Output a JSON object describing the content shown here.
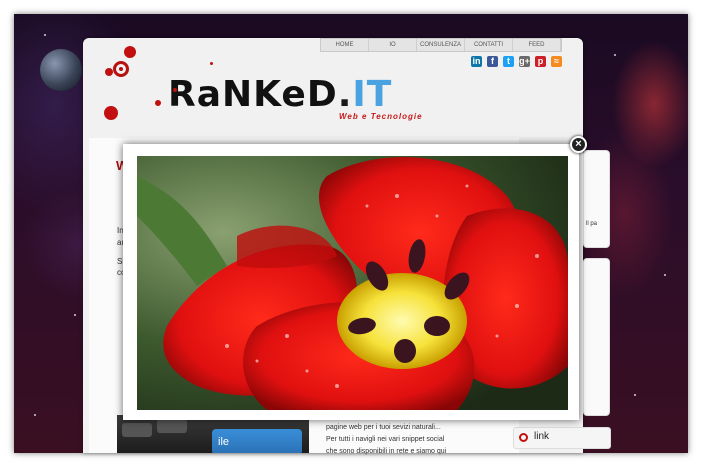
{
  "nav": {
    "items": [
      "HOME",
      "IO",
      "CONSULENZA",
      "CONTATTI",
      "FEED"
    ]
  },
  "social": {
    "icons": [
      "linkedin-icon",
      "facebook-icon",
      "twitter-icon",
      "googleplus-icon",
      "pinterest-icon",
      "rss-icon"
    ],
    "glyphs": [
      "in",
      "f",
      "t",
      "g+",
      "p",
      "≈"
    ],
    "colors": [
      "#0e76a8",
      "#3b5998",
      "#1da1f2",
      "#6a6a6a",
      "#cb2027",
      "#f58a1e"
    ]
  },
  "brand": {
    "name_main": "RaNKeD",
    "name_dot": ".",
    "name_tld": "IT",
    "tagline": "Web e Tecnologie",
    "accent_color": "#c21010"
  },
  "article": {
    "heading_initial": "W",
    "body_line_1": "pagine web per i tuoi sevizi naturali...",
    "body_line_2": "Per tutti i navigli nei vari snippet social",
    "body_line_3": "che sono disponibili in rete e siamo qui",
    "keyboard_key_label": "ile"
  },
  "sidebar": {
    "link_box_label": "link",
    "partial_text": "ll pa",
    "left_letters": [
      "In",
      "au",
      "Si",
      "co"
    ]
  },
  "lightbox": {
    "close_symbol": "×",
    "image_subject": "red tulip with water drops"
  }
}
